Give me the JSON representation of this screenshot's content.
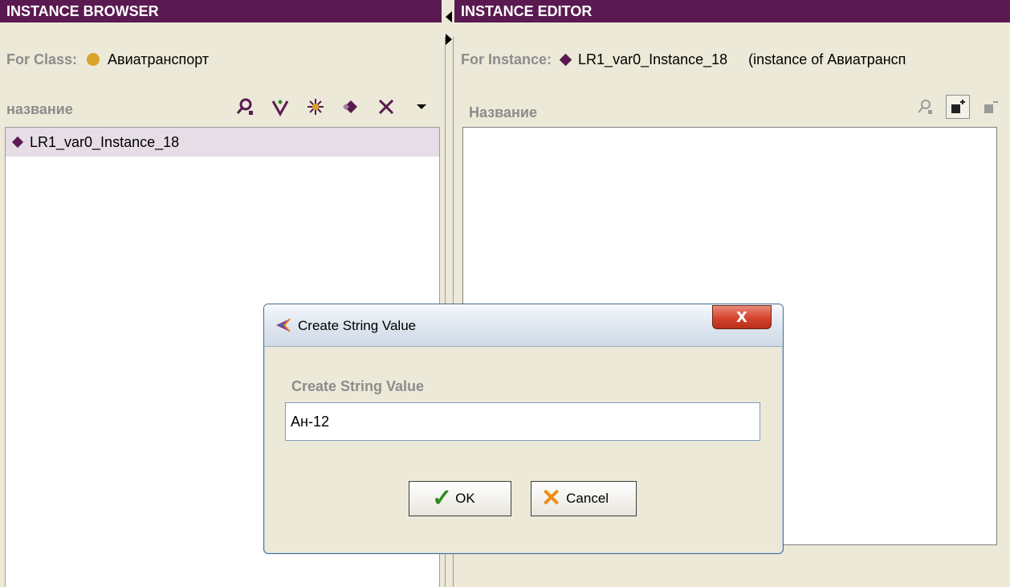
{
  "left_panel": {
    "header": "INSTANCE BROWSER",
    "for_class_label": "For Class:",
    "class_name": "Авиатранспорт",
    "column_label": "название",
    "toolbar_icons": [
      "find-instance-icon",
      "create-instance-icon",
      "configure-icon",
      "instance-diamond-icon",
      "delete-instance-icon",
      "dropdown-arrow-icon"
    ],
    "items": [
      {
        "label": "LR1_var0_Instance_18"
      }
    ]
  },
  "right_panel": {
    "header": "INSTANCE EDITOR",
    "for_instance_label": "For Instance:",
    "instance_name": "LR1_var0_Instance_18",
    "instance_of": "(instance of Авиатрансп",
    "column_label": "Название",
    "toolbar_icons": [
      "find-value-icon",
      "add-value-icon",
      "remove-value-icon"
    ]
  },
  "dialog": {
    "title": "Create String Value",
    "close_label": "X",
    "field_label": "Create String Value",
    "input_value": "Ан-12",
    "ok_label": "OK",
    "cancel_label": "Cancel"
  },
  "colors": {
    "header_bg": "#5a1a51",
    "class_dot": "#d9a328",
    "instance_diamond": "#5a1a51",
    "selected_row": "#e6dde6",
    "ok_check": "#2e8b1f",
    "cancel_x": "#f08c14"
  }
}
